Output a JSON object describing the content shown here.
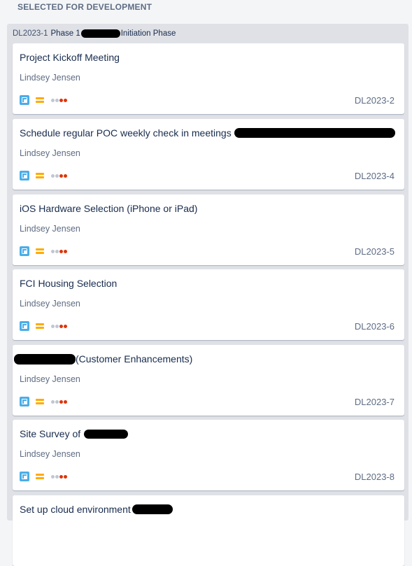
{
  "column": {
    "title": "SELECTED FOR DEVELOPMENT"
  },
  "epic": {
    "key": "DL2023-1",
    "label_prefix": "Phase 1",
    "label_suffix": "Initiation Phase"
  },
  "colors": {
    "story_icon": "#4bade8",
    "priority_medium": "#ffab00",
    "estimate_red": "#de350b",
    "estimate_grey": "#c1c7d0"
  },
  "cards": [
    {
      "title": "Project Kickoff Meeting",
      "title_after": "",
      "assignee": "Lindsey Jensen",
      "key": "DL2023-2",
      "type_icon": "story-icon",
      "priority_icon": "medium-priority-icon"
    },
    {
      "title": "Schedule regular POC weekly check in meetings",
      "title_after": "",
      "assignee": "Lindsey Jensen",
      "key": "DL2023-4",
      "type_icon": "story-icon",
      "priority_icon": "medium-priority-icon"
    },
    {
      "title": "iOS Hardware Selection (iPhone or iPad)",
      "title_after": "",
      "assignee": "Lindsey Jensen",
      "key": "DL2023-5",
      "type_icon": "story-icon",
      "priority_icon": "medium-priority-icon"
    },
    {
      "title": "FCI Housing Selection",
      "title_after": "",
      "assignee": "Lindsey Jensen",
      "key": "DL2023-6",
      "type_icon": "story-icon",
      "priority_icon": "medium-priority-icon"
    },
    {
      "title": "",
      "title_after": "(Customer Enhancements)",
      "assignee": "Lindsey Jensen",
      "key": "DL2023-7",
      "type_icon": "story-icon",
      "priority_icon": "medium-priority-icon"
    },
    {
      "title": "Site Survey of",
      "title_after": "",
      "assignee": "Lindsey Jensen",
      "key": "DL2023-8",
      "type_icon": "story-icon",
      "priority_icon": "medium-priority-icon"
    },
    {
      "title": "Set up cloud environment",
      "title_after": "",
      "assignee": "",
      "key": "",
      "type_icon": "story-icon",
      "priority_icon": "medium-priority-icon"
    }
  ]
}
